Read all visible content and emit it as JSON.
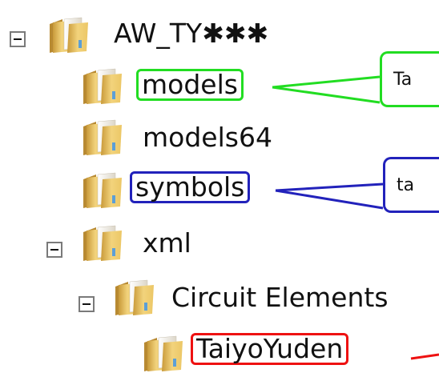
{
  "tree": {
    "root": {
      "label": "AW_TY✱✱✱",
      "expanded": true
    },
    "children": [
      {
        "label": "models"
      },
      {
        "label": "models64"
      },
      {
        "label": "symbols"
      },
      {
        "label": "xml",
        "expanded": true
      },
      {
        "label": "Circuit Elements",
        "expanded": true
      },
      {
        "label": "TaiyoYuden"
      }
    ]
  },
  "callouts": {
    "models": {
      "text": "Ta",
      "color": "#22dd22"
    },
    "symbols": {
      "text": "ta",
      "color": "#2222bb"
    },
    "taiyoyuden": {
      "color": "#ee1111"
    }
  },
  "icons": {
    "folder": "folder-icon",
    "collapse": "minus-box-icon"
  }
}
